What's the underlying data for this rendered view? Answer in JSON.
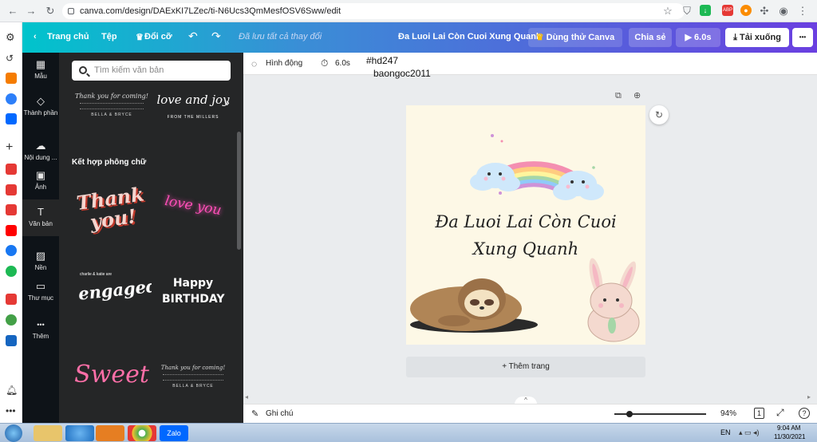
{
  "browser": {
    "url": "canva.com/design/DAExKI7LZec/ti-N6Ucs3QmMesfOSV6Sww/edit",
    "extensions": [
      {
        "name": "download-ext-icon",
        "color": "#1db954",
        "glyph": "↓"
      },
      {
        "name": "abp-ext-icon",
        "color": "#e53935",
        "glyph": "ABP"
      },
      {
        "name": "color-ext-icon",
        "color": "#fb8c00",
        "glyph": "●"
      }
    ]
  },
  "topbar": {
    "home_label": "Trang chủ",
    "file_label": "Tệp",
    "resize_label": "Đổi cỡ",
    "saved_status": "Đã lưu tất cả thay đổi",
    "design_title": "Đa Luoi Lai Còn Cuoi Xung Quanh",
    "try_pro_label": "Dùng thử Canva Pro",
    "share_label": "Chia sẻ",
    "play_label": "6.0s",
    "download_label": "Tải xuống",
    "more_label": "•••"
  },
  "side_menu": [
    {
      "label": "Mẫu",
      "icon": "template-icon",
      "glyph": "▦"
    },
    {
      "label": "Thành phần",
      "icon": "elements-icon",
      "glyph": "◇"
    },
    {
      "label": "Nội dung ...",
      "icon": "upload-cloud-icon",
      "glyph": "☁"
    },
    {
      "label": "Ảnh",
      "icon": "photo-icon",
      "glyph": "▣"
    },
    {
      "label": "Văn bản",
      "icon": "text-icon",
      "glyph": "T"
    },
    {
      "label": "Nền",
      "icon": "background-icon",
      "glyph": "▨"
    },
    {
      "label": "Thư mục",
      "icon": "folder-icon",
      "glyph": "▭"
    },
    {
      "label": "Thêm",
      "icon": "more-dots-icon",
      "glyph": "•••"
    }
  ],
  "panel": {
    "search_placeholder": "Tìm kiếm văn bản",
    "section_title": "Kết hợp phông chữ",
    "top_cards": [
      {
        "title": "Thank you for coming!",
        "footer": "BELLA & BRYCE"
      },
      {
        "title": "love and joy",
        "footer": "FROM THE MILLERS"
      }
    ],
    "cards": [
      {
        "text": "Thank you!",
        "color": "#f6d5cf"
      },
      {
        "text": "love you",
        "color": "#ff4fb8"
      },
      {
        "text": "engaged!",
        "small": "charlie & katie are",
        "color": "#ffffff"
      },
      {
        "text": "Happy BIRTHDAY",
        "color": "#ffffff"
      },
      {
        "text": "Sweet",
        "color": "#ff6fa8"
      },
      {
        "text": "Thank you for coming!",
        "footer": "BELLA & BRYCE",
        "color": "#dddddd"
      }
    ]
  },
  "editor": {
    "animate_label": "Hình động",
    "duration_label": "6.0s",
    "overlay_lines": [
      "#hd247",
      "baongoc2011"
    ],
    "canvas_title_line1": "Đa Luoi Lai Còn Cuoi",
    "canvas_title_line2": "Xung Quanh",
    "add_page_label": "+ Thêm trang",
    "notes_label": "Ghi chú",
    "zoom_value": "94%",
    "zoom_fraction": 0.94,
    "page_count": "1"
  },
  "taskbar": {
    "language": "EN",
    "time": "9:04 AM",
    "date": "11/30/2021",
    "apps": [
      "start-orb",
      "file-explorer",
      "internet-explorer",
      "media-player",
      "chrome",
      "zalo"
    ]
  },
  "colors": {
    "topbar_gradient_start": "#00c4cc",
    "topbar_gradient_end": "#6a3fe0",
    "panel_bg": "#252627",
    "side_bg": "#0e1318",
    "canvas_bg": "#fdf8e6"
  }
}
